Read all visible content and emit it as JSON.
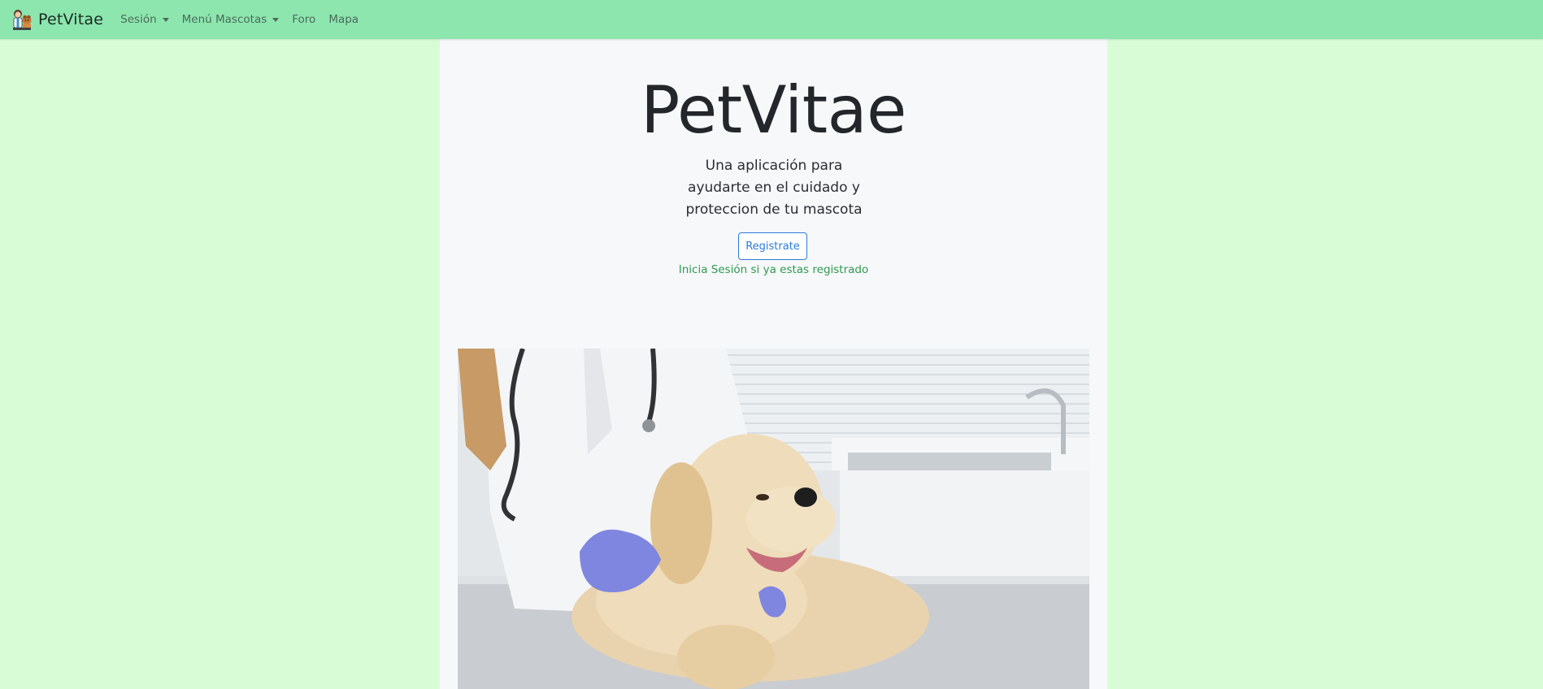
{
  "navbar": {
    "brand_text": "PetVitae",
    "brand_icon": "pet-doctor-logo-icon",
    "items": [
      {
        "label": "Sesión",
        "dropdown": true
      },
      {
        "label": "Menú Mascotas",
        "dropdown": true
      },
      {
        "label": "Foro",
        "dropdown": false
      },
      {
        "label": "Mapa",
        "dropdown": false
      }
    ]
  },
  "hero": {
    "title": "PetVitae",
    "subtitle": "Una aplicación para ayudarte en el cuidado y proteccion de tu mascota",
    "register_button": "Registrate",
    "login_link": "Inicia Sesión si ya estas registrado",
    "image_icon": "veterinarian-with-puppy-photo"
  },
  "colors": {
    "page_background": "#d8fdd6",
    "navbar_background": "#8ce6ae",
    "content_background": "#f7f8fa",
    "button_accent": "#2b7bdb",
    "link_green": "#2e9a4f"
  }
}
